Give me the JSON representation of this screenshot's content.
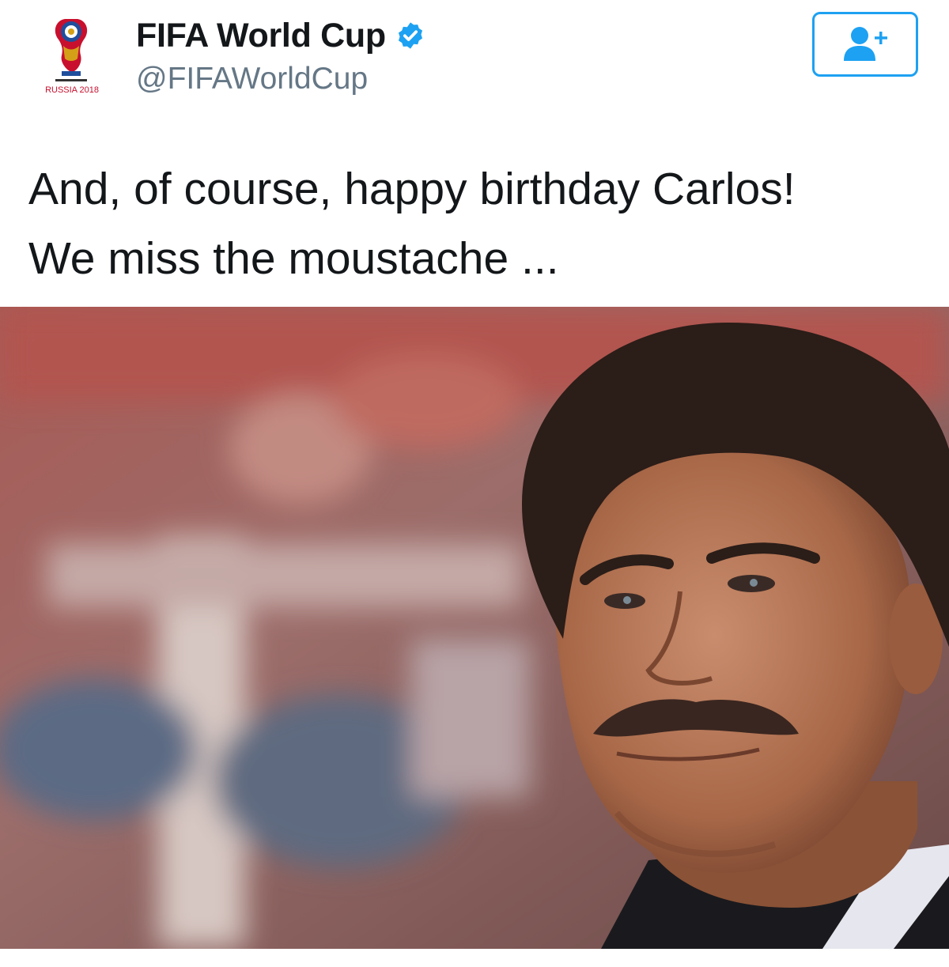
{
  "account": {
    "display_name": "FIFA World Cup",
    "handle": "@FIFAWorldCup",
    "verified": true,
    "avatar_logo_text": "RUSSIA 2018"
  },
  "follow_button": {
    "icon": "follow-user-plus-icon"
  },
  "tweet": {
    "lines": [
      "And, of course, happy birthday Carlos!",
      "We miss the moustache ..."
    ]
  },
  "media": {
    "description_icon": "photo"
  },
  "colors": {
    "accent": "#1da1f2",
    "name_text": "#14171a",
    "handle_text": "#657786",
    "logo_red": "#c8102e"
  }
}
